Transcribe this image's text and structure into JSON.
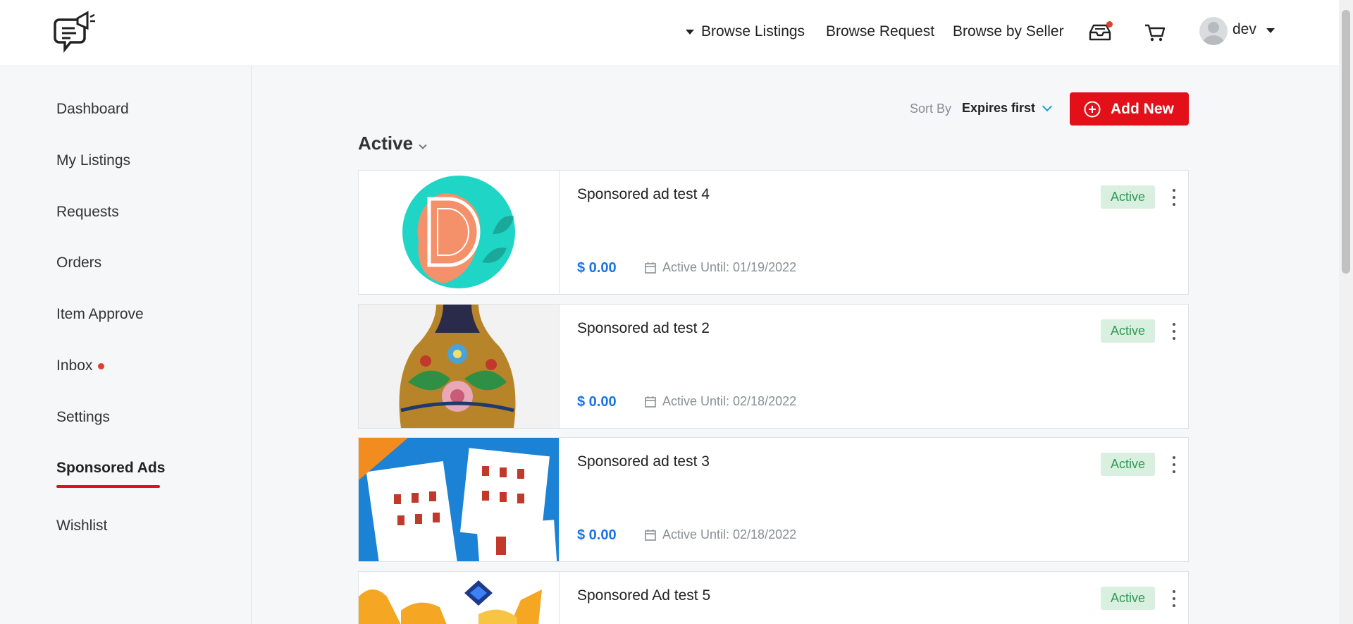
{
  "header": {
    "nav": {
      "browse_listings": "Browse Listings",
      "browse_request": "Browse Request",
      "browse_by_seller": "Browse by Seller"
    },
    "user": {
      "name": "dev"
    },
    "icons": [
      "logo-icon",
      "inbox-icon",
      "cart-icon",
      "avatar-icon"
    ]
  },
  "sidebar": {
    "items": [
      {
        "label": "Dashboard"
      },
      {
        "label": "My Listings"
      },
      {
        "label": "Requests"
      },
      {
        "label": "Orders"
      },
      {
        "label": "Item Approve"
      },
      {
        "label": "Inbox",
        "has_notification": true
      },
      {
        "label": "Settings"
      },
      {
        "label": "Sponsored Ads",
        "active": true
      },
      {
        "label": "Wishlist"
      }
    ]
  },
  "toolbar": {
    "sort_label": "Sort By",
    "sort_value": "Expires first",
    "add_new_label": "Add New"
  },
  "section": {
    "title": "Active"
  },
  "ads": [
    {
      "title": "Sponsored ad test 4",
      "price": "$ 0.00",
      "until": "Active Until: 01/19/2022",
      "status": "Active"
    },
    {
      "title": "Sponsored ad test 2",
      "price": "$ 0.00",
      "until": "Active Until: 02/18/2022",
      "status": "Active"
    },
    {
      "title": "Sponsored ad test 3",
      "price": "$ 0.00",
      "until": "Active Until: 02/18/2022",
      "status": "Active"
    },
    {
      "title": "Sponsored Ad test 5",
      "price": "",
      "until": "",
      "status": "Active"
    }
  ],
  "colors": {
    "brand_red": "#e3101a",
    "price_blue": "#1a73e8",
    "status_green_bg": "#d9efe0",
    "status_green_text": "#2f9a55"
  }
}
